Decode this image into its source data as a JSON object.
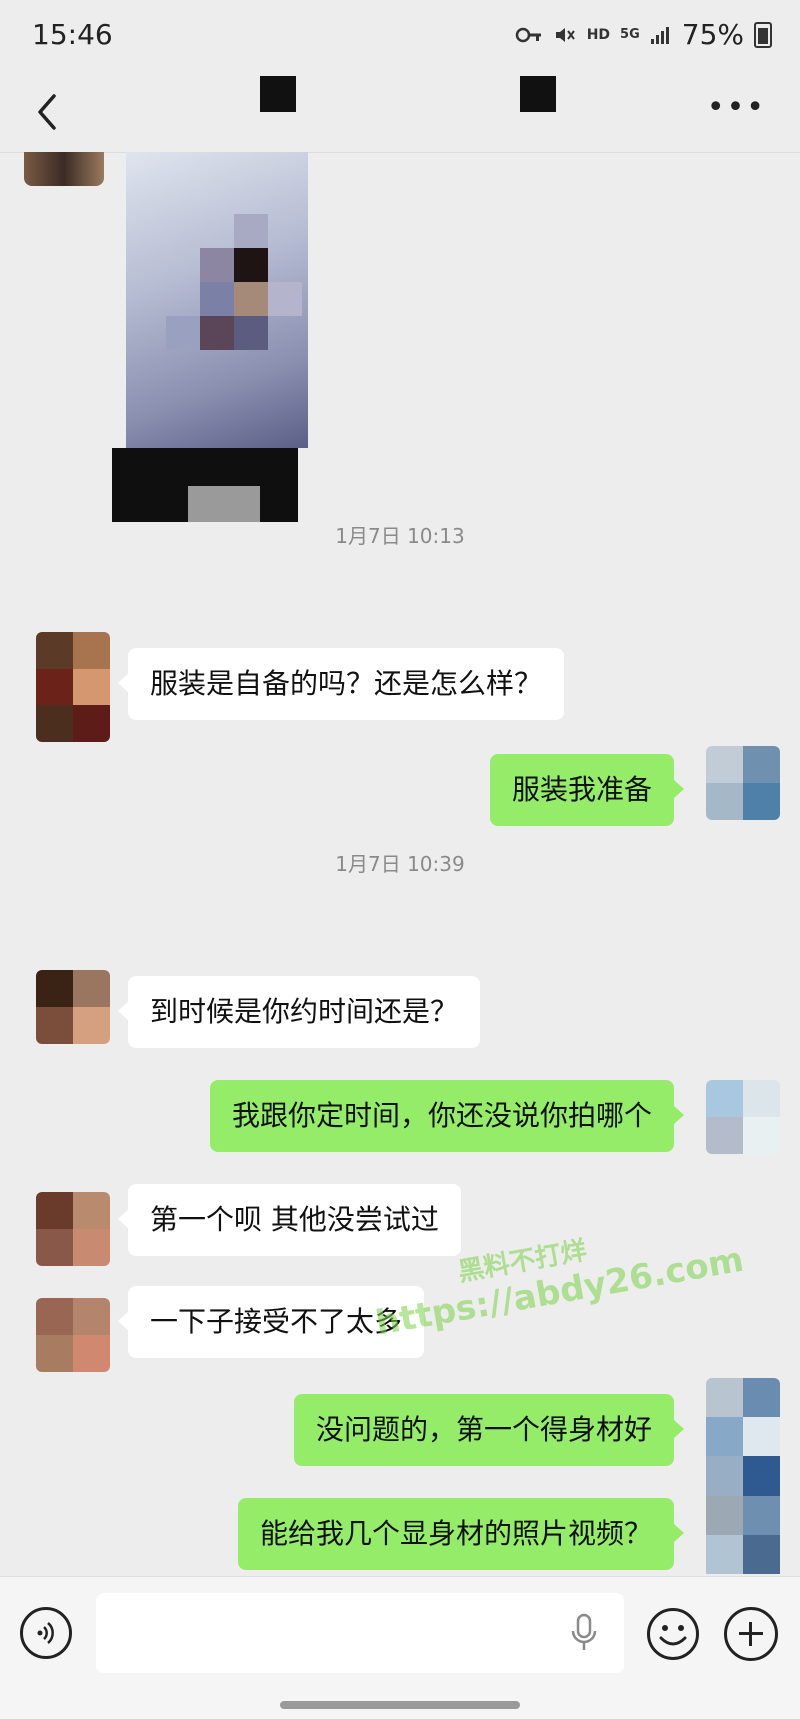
{
  "status_bar": {
    "time": "15:46",
    "icons": [
      "key-icon",
      "mute-icon",
      "hd-icon",
      "5g-icon",
      "signal-icon"
    ],
    "hd_label": "HD",
    "net_label": "5G",
    "battery": "75%"
  },
  "header": {
    "back_icon": "chevron-left-icon",
    "more_label": "•••"
  },
  "messages": [
    {
      "side": "left",
      "type": "image"
    },
    {
      "type": "timestamp",
      "text": "1月7日 10:13"
    },
    {
      "side": "left",
      "text": "服装是自备的吗？还是怎么样？"
    },
    {
      "side": "right",
      "text": "服装我准备"
    },
    {
      "type": "timestamp",
      "text": "1月7日 10:39"
    },
    {
      "side": "left",
      "text": "到时候是你约时间还是？"
    },
    {
      "side": "right",
      "text": "我跟你定时间，你还没说你拍哪个"
    },
    {
      "side": "left",
      "text": "第一个呗 其他没尝试过"
    },
    {
      "side": "left",
      "text": "一下子接受不了太多"
    },
    {
      "side": "right",
      "text": "没问题的，第一个得身材好"
    },
    {
      "side": "right",
      "text": "能给我几个显身材的照片视频？"
    }
  ],
  "watermark": {
    "line1": "黑料不打烊",
    "line2": "https://abdy26.com"
  },
  "input_bar": {
    "placeholder": "",
    "icons": [
      "voice-icon",
      "mic-icon",
      "emoji-icon",
      "plus-icon"
    ]
  },
  "colors": {
    "background": "#ededed",
    "bubble_right": "#95ec69",
    "bubble_left": "#ffffff",
    "timestamp": "#8a8a8a"
  }
}
